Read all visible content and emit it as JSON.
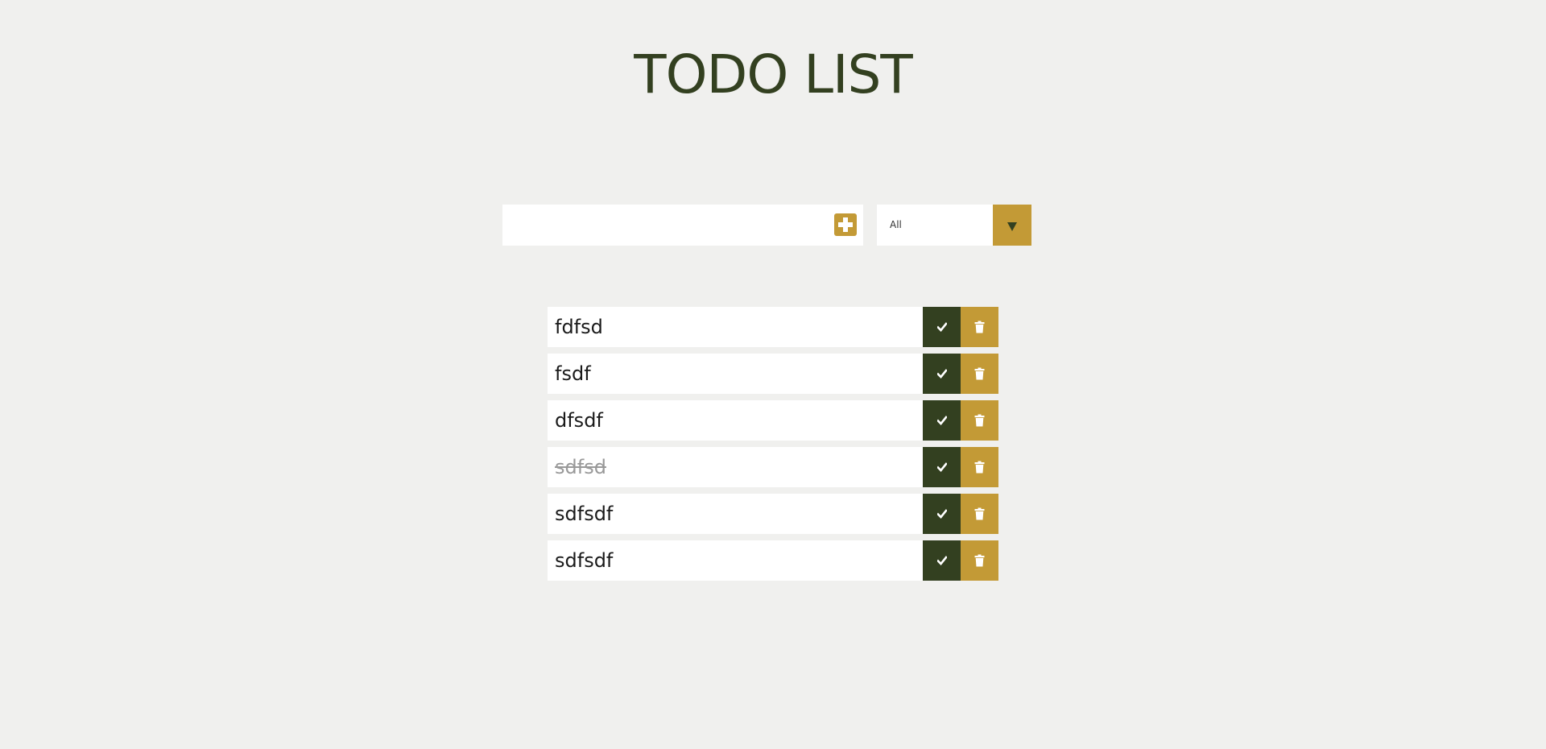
{
  "header": {
    "title": "TODO LIST"
  },
  "form": {
    "input_value": "",
    "input_placeholder": "",
    "add_icon": "plus-square-icon",
    "filter": {
      "selected": "All"
    }
  },
  "todos": [
    {
      "text": "fdfsd",
      "completed": false
    },
    {
      "text": "fsdf",
      "completed": false
    },
    {
      "text": "dfsdf",
      "completed": false
    },
    {
      "text": "sdfsd",
      "completed": true
    },
    {
      "text": "sdfsdf",
      "completed": false
    },
    {
      "text": "sdfsdf",
      "completed": false
    }
  ],
  "icons": {
    "complete": "check-icon",
    "delete": "trash-icon"
  },
  "colors": {
    "background": "#f0f0ee",
    "primary_dark": "#334020",
    "accent_gold": "#c39a36",
    "item_bg": "#ffffff",
    "completed_text": "#999999"
  }
}
